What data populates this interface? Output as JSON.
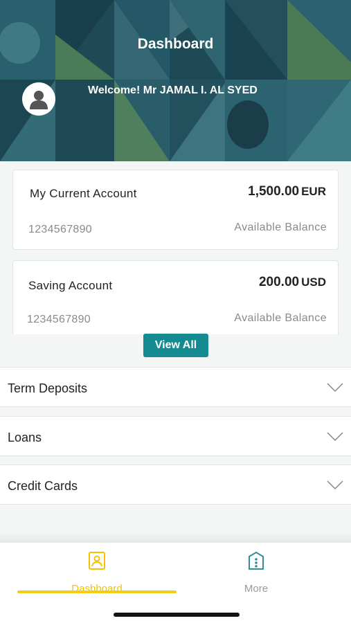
{
  "header": {
    "title": "Dashboard",
    "welcome": "Welcome! Mr JAMAL I. AL SYED"
  },
  "accounts": [
    {
      "name": "My Current Account",
      "amount": "1,500.00",
      "currency": "EUR",
      "number": "1234567890",
      "balance_label": "Available Balance"
    },
    {
      "name": "Saving Account",
      "amount": "200.00",
      "currency": "USD",
      "number": "1234567890",
      "balance_label": "Available Balance"
    }
  ],
  "view_all_label": "View All",
  "sections": [
    {
      "label": "Term Deposits"
    },
    {
      "label": "Loans"
    },
    {
      "label": "Credit Cards"
    }
  ],
  "tabs": [
    {
      "label": "Dashboard",
      "icon": "dashboard-icon",
      "active": true
    },
    {
      "label": "More",
      "icon": "more-icon",
      "active": false
    }
  ],
  "colors": {
    "accent": "#138b91",
    "active_tab": "#f2c400",
    "header_dark": "#1f4f5c"
  }
}
